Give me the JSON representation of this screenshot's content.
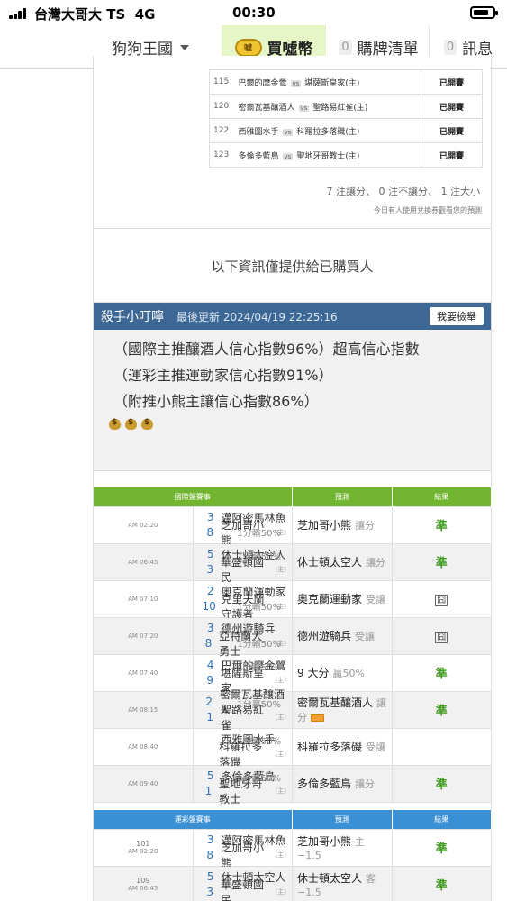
{
  "status": {
    "carrier": "台灣大哥大 TS",
    "network": "4G",
    "time": "00:30"
  },
  "nav": {
    "kingdom": "狗狗王國",
    "buy": "買噓幣",
    "coin_text": "噓",
    "list_count": "0",
    "list": "購牌清單",
    "msg_count": "0",
    "msg": "訊息"
  },
  "prev": {
    "rows": [
      {
        "num": "115",
        "away": "巴爾的摩金鶯",
        "vs": "vs",
        "home": "堪薩斯皇家(主)",
        "state": "已開賽"
      },
      {
        "num": "120",
        "away": "密爾瓦基釀酒人",
        "vs": "vs",
        "home": "聖路易紅雀(主)",
        "state": "已開賽"
      },
      {
        "num": "122",
        "away": "西雅圖水手",
        "vs": "vs",
        "home": "科羅拉多落磯(主)",
        "state": "已開賽"
      },
      {
        "num": "123",
        "away": "多倫多藍鳥",
        "vs": "vs",
        "home": "聖地牙哥教士(主)",
        "state": "已開賽"
      }
    ],
    "summary": "7 注讓分、 0 注不讓分、 1 注大小",
    "note": "今日有人使用兌換券觀看您的預測"
  },
  "only_buyers": "以下資訊僅提供給已購買人",
  "tip": {
    "author": "殺手小叮嚀",
    "updated": "最後更新 2024/04/19 22:25:16",
    "report": "我要檢舉",
    "lines": [
      "（國際主推釀酒人信心指數96%）超高信心指數",
      "（運彩主推運動家信心指數91%）",
      "（附推小熊主讓信心指數86%）"
    ]
  },
  "intl": {
    "headers": {
      "game": "國際盤賽事",
      "pred": "預測",
      "result": "結果"
    },
    "rows": [
      {
        "time": "AM 02:20",
        "s1": "3",
        "t1": "邁阿密馬林魚",
        "h1": "",
        "l1": "",
        "s2": "8",
        "t2": "芝加哥小熊",
        "h2": "(主)",
        "l2": "1分輸50%",
        "pick": "芝加哥小熊",
        "sub": "讓分",
        "result": "準"
      },
      {
        "time": "AM 06:45",
        "s1": "5",
        "t1": "休士頓太空人",
        "h1": "",
        "l1": "1分輸50%",
        "s2": "3",
        "t2": "華盛頓國民",
        "h2": "(主)",
        "l2": "",
        "pick": "休士頓太空人",
        "sub": "讓分",
        "result": "準"
      },
      {
        "time": "AM 07:10",
        "s1": "2",
        "t1": "奧克蘭運動家",
        "h1": "",
        "l1": "",
        "s2": "10",
        "t2": "克里夫蘭守護者",
        "h2": "(主)",
        "l2": "1分輸50%",
        "pick": "奧克蘭運動家",
        "sub": "受讓",
        "result": "囧"
      },
      {
        "time": "AM 07:20",
        "s1": "3",
        "t1": "德州遊騎兵",
        "h1": "",
        "l1": "",
        "s2": "8",
        "t2": "亞特蘭大勇士",
        "h2": "(主)",
        "l2": "1分輸50%",
        "pick": "德州遊騎兵",
        "sub": "受讓",
        "result": "囧"
      },
      {
        "time": "AM 07:40",
        "s1": "4",
        "t1": "巴爾的摩金鶯",
        "h1": "",
        "l1": "1分贏50%",
        "s2": "9",
        "t2": "堪薩斯皇家",
        "h2": "(主)",
        "l2": "",
        "pick": "9 大分",
        "sub": "贏50%",
        "result": "準"
      },
      {
        "time": "AM 08:15",
        "s1": "2",
        "t1": "密爾瓦基釀酒人",
        "h1": "",
        "l1": "1分贏50%",
        "s2": "1",
        "t2": "聖路易紅雀",
        "h2": "(主)",
        "l2": "",
        "pick": "密爾瓦基釀酒人",
        "sub": "讓分",
        "result": "準",
        "tag": true
      },
      {
        "time": "AM 08:40",
        "s1": "",
        "t1": "西雅圖水手",
        "h1": "",
        "l1": "1分輸50%",
        "s2": "",
        "t2": "科羅拉多落磯",
        "h2": "(主)",
        "l2": "",
        "pick": "科羅拉多落磯",
        "sub": "受讓",
        "result": ""
      },
      {
        "time": "AM 09:40",
        "s1": "5",
        "t1": "多倫多藍鳥",
        "h1": "",
        "l1": "1分贏50%",
        "s2": "1",
        "t2": "聖地牙哥教士",
        "h2": "(主)",
        "l2": "",
        "pick": "多倫多藍鳥",
        "sub": "讓分",
        "result": "準"
      }
    ]
  },
  "sport": {
    "headers": {
      "game": "運彩盤賽事",
      "pred": "預測",
      "result": "結果"
    },
    "rows": [
      {
        "num": "101",
        "time": "AM 02:20",
        "s1": "3",
        "t1": "邁阿密馬林魚",
        "h1": "",
        "s2": "8",
        "t2": "芝加哥小熊",
        "h2": "(主)",
        "pick": "芝加哥小熊",
        "sub": "主 −1.5",
        "result": "準"
      },
      {
        "num": "109",
        "time": "AM 06:45",
        "s1": "5",
        "t1": "休士頓太空人",
        "h1": "",
        "s2": "3",
        "t2": "華盛頓國民",
        "h2": "(主)",
        "pick": "休士頓太空人",
        "sub": "客 −1.5",
        "result": "準"
      }
    ]
  }
}
